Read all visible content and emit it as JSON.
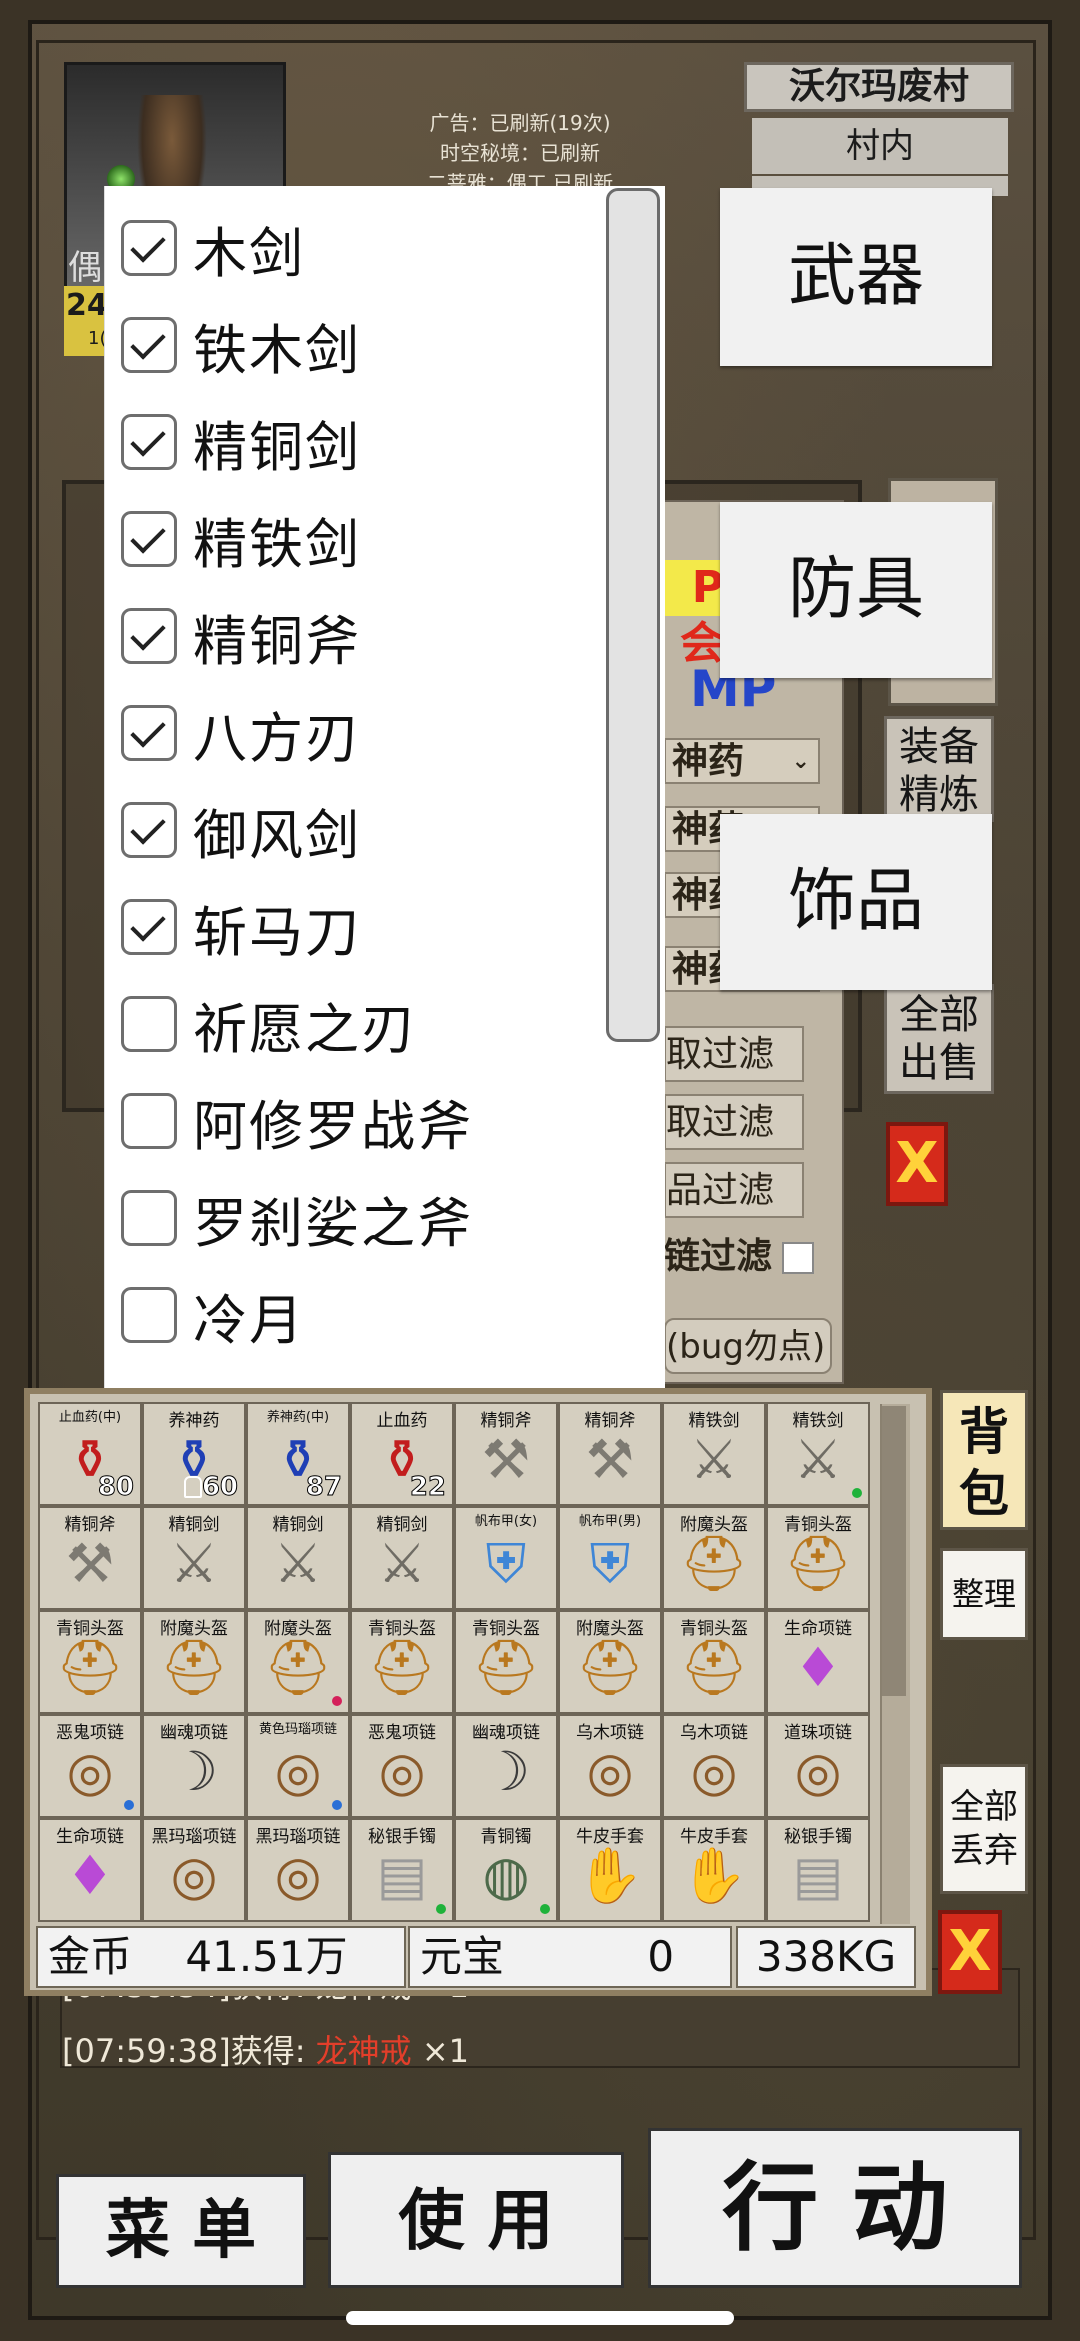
{
  "header": {
    "portrait_name_fragment": "偶",
    "level": "24",
    "level_sub": "1(",
    "info_lines": [
      "广告：已刷新(19次)",
      "时空秘境：已刷新",
      "二菩雅：偶工 已刷新"
    ],
    "location": "沃尔玛废村",
    "sublocation": "村内"
  },
  "background_panel": {
    "vip_fragment": "P会",
    "mp_label": "MP",
    "potion_rows": [
      "神药",
      "神药",
      "神药",
      "神药"
    ],
    "filter_rows": [
      "取过滤",
      "取过滤",
      "品过滤",
      "链过滤"
    ],
    "bug_label": "(bug勿点)",
    "side_buttons": {
      "refine": "装备精炼",
      "sell_all": "全部出售",
      "close": "X"
    }
  },
  "filter_list": {
    "items": [
      {
        "label": "木剑",
        "checked": true
      },
      {
        "label": "铁木剑",
        "checked": true
      },
      {
        "label": "精铜剑",
        "checked": true
      },
      {
        "label": "精铁剑",
        "checked": true
      },
      {
        "label": "精铜斧",
        "checked": true
      },
      {
        "label": "八方刃",
        "checked": true
      },
      {
        "label": "御风剑",
        "checked": true
      },
      {
        "label": "斩马刀",
        "checked": true
      },
      {
        "label": "祈愿之刃",
        "checked": false
      },
      {
        "label": "阿修罗战斧",
        "checked": false
      },
      {
        "label": "罗刹娑之斧",
        "checked": false
      },
      {
        "label": "冷月",
        "checked": false
      }
    ]
  },
  "categories": {
    "weapon": "武器",
    "armor": "防具",
    "accessory": "饰品"
  },
  "inventory": {
    "items": [
      {
        "name": "止血药(中)",
        "icon": "red-potion",
        "count": "80"
      },
      {
        "name": "养神药",
        "icon": "blue-potion",
        "count": "60",
        "bound": true
      },
      {
        "name": "养神药(中)",
        "icon": "blue-potion",
        "count": "87"
      },
      {
        "name": "止血药",
        "icon": "red-potion",
        "count": "22"
      },
      {
        "name": "精铜斧",
        "icon": "axe"
      },
      {
        "name": "精铜斧",
        "icon": "axe"
      },
      {
        "name": "精铁剑",
        "icon": "sword"
      },
      {
        "name": "精铁剑",
        "icon": "sword",
        "dot": "#1fb23a"
      },
      {
        "name": "精铜斧",
        "icon": "axe"
      },
      {
        "name": "精铜剑",
        "icon": "sword"
      },
      {
        "name": "精铜剑",
        "icon": "sword"
      },
      {
        "name": "精铜剑",
        "icon": "sword"
      },
      {
        "name": "帆布甲(女)",
        "icon": "armor"
      },
      {
        "name": "帆布甲(男)",
        "icon": "armor"
      },
      {
        "name": "附魔头盔",
        "icon": "helmet"
      },
      {
        "name": "青铜头盔",
        "icon": "helmet"
      },
      {
        "name": "青铜头盔",
        "icon": "helmet"
      },
      {
        "name": "附魔头盔",
        "icon": "helmet"
      },
      {
        "name": "附魔头盔",
        "icon": "helmet",
        "dot": "#d4205a"
      },
      {
        "name": "青铜头盔",
        "icon": "helmet"
      },
      {
        "name": "青铜头盔",
        "icon": "helmet"
      },
      {
        "name": "附魔头盔",
        "icon": "helmet"
      },
      {
        "name": "青铜头盔",
        "icon": "helmet"
      },
      {
        "name": "生命项链",
        "icon": "gem-necklace"
      },
      {
        "name": "恶鬼项链",
        "icon": "necklace",
        "dot": "#2a6fd6"
      },
      {
        "name": "幽魂项链",
        "icon": "fang"
      },
      {
        "name": "黄色玛瑙项链",
        "icon": "necklace",
        "dot": "#2a6fd6"
      },
      {
        "name": "恶鬼项链",
        "icon": "necklace"
      },
      {
        "name": "幽魂项链",
        "icon": "fang"
      },
      {
        "name": "乌木项链",
        "icon": "necklace"
      },
      {
        "name": "乌木项链",
        "icon": "necklace"
      },
      {
        "name": "道珠项链",
        "icon": "necklace"
      },
      {
        "name": "生命项链",
        "icon": "gem-necklace"
      },
      {
        "name": "黑玛瑙项链",
        "icon": "necklace"
      },
      {
        "name": "黑玛瑙项链",
        "icon": "necklace"
      },
      {
        "name": "秘银手镯",
        "icon": "bracelet",
        "dot": "#1fb23a"
      },
      {
        "name": "青铜镯",
        "icon": "ring",
        "dot": "#1fb23a"
      },
      {
        "name": "牛皮手套",
        "icon": "glove"
      },
      {
        "name": "牛皮手套",
        "icon": "glove"
      },
      {
        "name": "秘银手镯",
        "icon": "bracelet"
      }
    ],
    "gold_label": "金币",
    "gold_value": "41.51万",
    "ingot_label": "元宝",
    "ingot_value": "0",
    "weight": "338KG",
    "bag_label": "背包",
    "sort_label": "整理",
    "discard_all_label": "全部丢弃",
    "close_label": "X"
  },
  "log": {
    "top_fragment": "[07:59:34]获得: 龙神戒 ×1",
    "time": "[07:59:38]",
    "prefix": "获得: ",
    "item": "龙神戒",
    "suffix": " ×1"
  },
  "bottom_bar": {
    "menu": "菜 单",
    "use": "使 用",
    "action": "行 动"
  },
  "colors": {
    "accent_red": "#d52a1b",
    "item_red": "#e33e2a",
    "mp_blue": "#2546c9"
  }
}
